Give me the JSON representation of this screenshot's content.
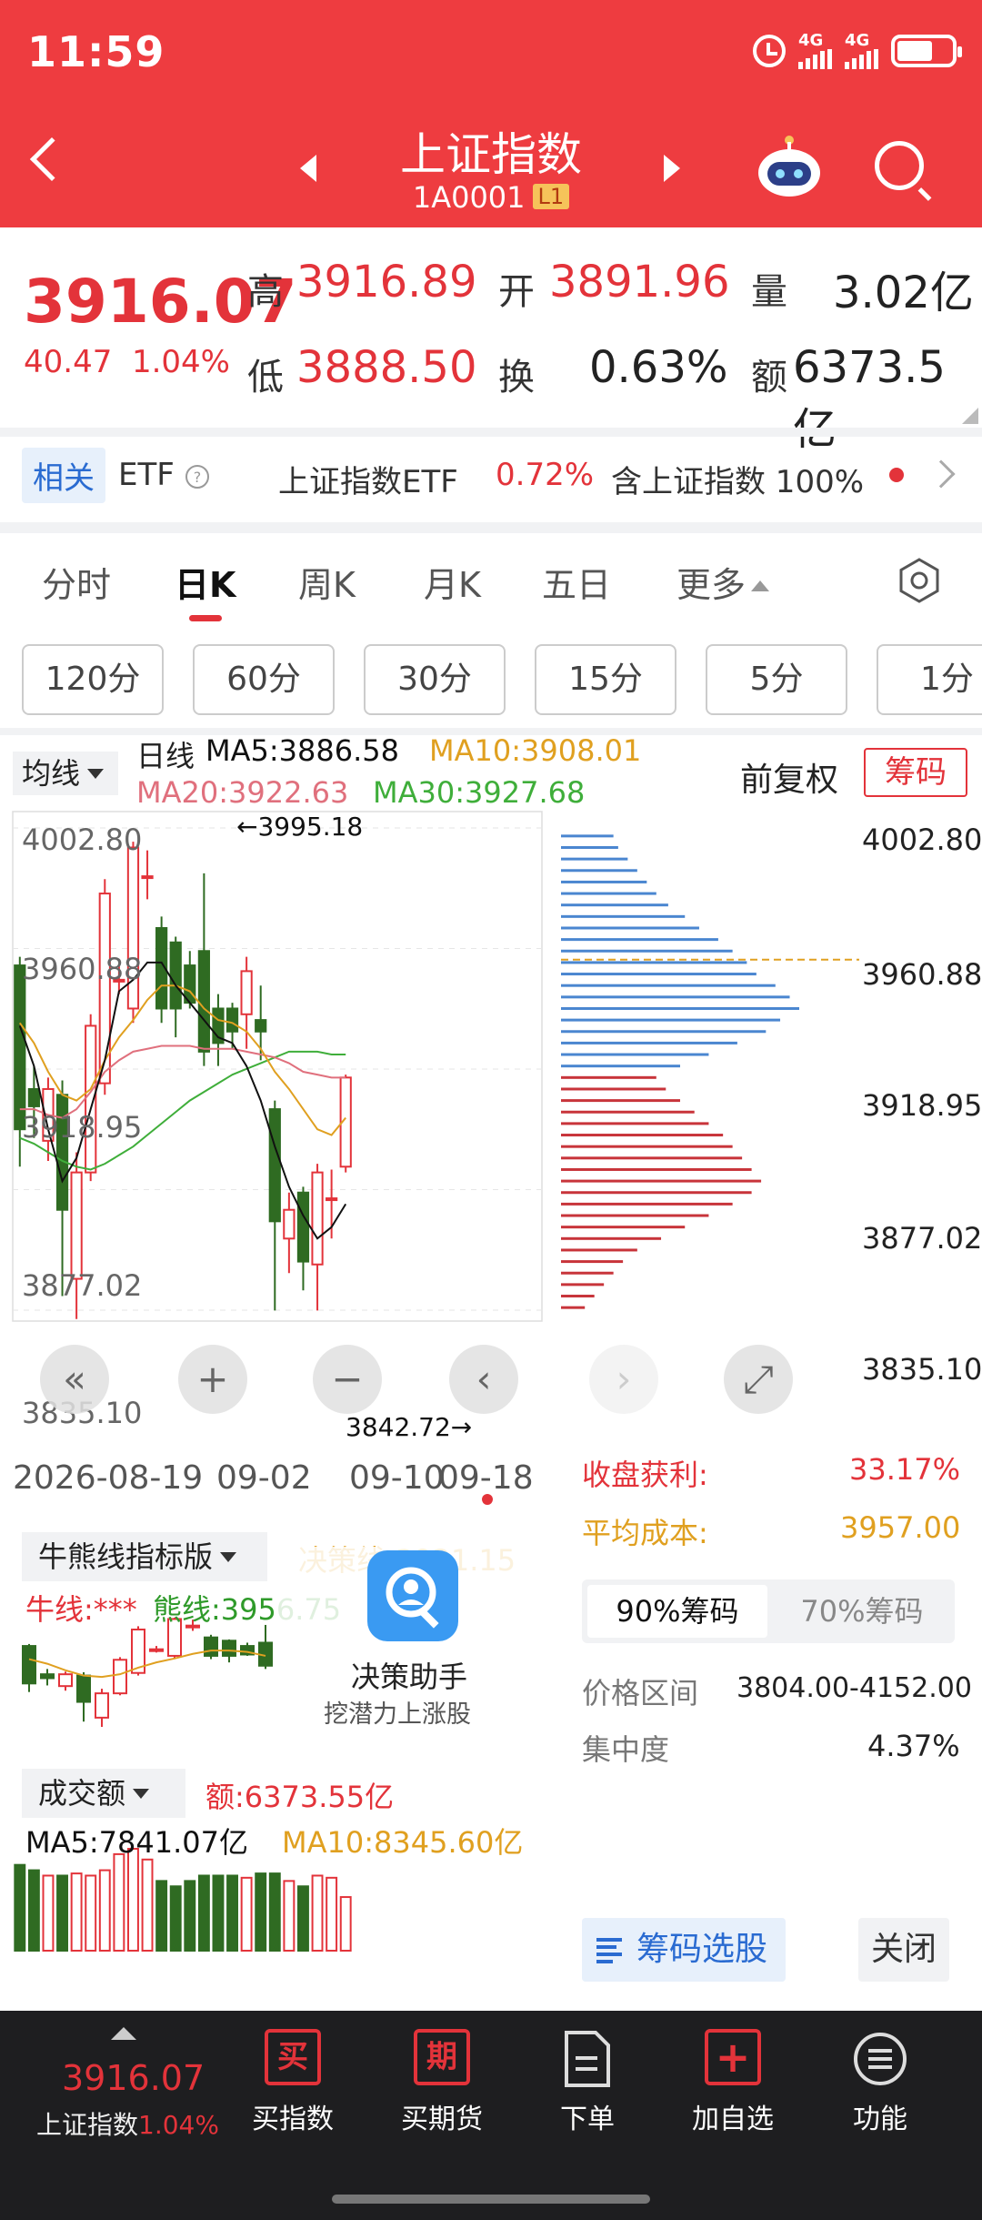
{
  "status": {
    "time": "11:59",
    "net1": "4G",
    "net2": "4G"
  },
  "header": {
    "title": "上证指数",
    "code": "1A0001",
    "badge": "L1"
  },
  "quote": {
    "price": "3916.07",
    "change": "40.47",
    "change_pct": "1.04%",
    "high_label": "高",
    "high": "3916.89",
    "open_label": "开",
    "open": "3891.96",
    "volume_label": "量",
    "volume": "3.02亿",
    "low_label": "低",
    "low": "3888.50",
    "turnover_label": "换",
    "turnover": "0.63%",
    "amount_label": "额",
    "amount": "6373.5亿"
  },
  "etf": {
    "tag": "相关",
    "label": "ETF",
    "name": "上证指数ETF",
    "pct": "0.72%",
    "contains": "含上证指数 100%"
  },
  "tabs": [
    "分时",
    "日K",
    "周K",
    "月K",
    "五日",
    "更多"
  ],
  "periods": [
    "120分",
    "60分",
    "30分",
    "15分",
    "5分",
    "1分"
  ],
  "ma": {
    "selector": "均线",
    "kind": "日线",
    "ma5": "MA5:3886.58",
    "ma10": "MA10:3908.01",
    "ma20": "MA20:3922.63",
    "ma30": "MA30:3927.68",
    "fuquan": "前复权",
    "chouma": "筹码"
  },
  "chart_axis": {
    "y_labels": [
      "4002.80",
      "3960.88",
      "3918.95",
      "3877.02",
      "3835.10"
    ],
    "max_annot": "←3995.18",
    "min_annot": "3842.72→"
  },
  "chip_axis": {
    "y_labels": [
      "4002.80",
      "3960.88",
      "3918.95",
      "3877.02",
      "3835.10"
    ]
  },
  "dates": {
    "d1": "2026-08-19",
    "d2": "09-02",
    "d3": "09-10",
    "d4": "09-18"
  },
  "chip_info": {
    "profit_label": "收盘获利:",
    "profit": "33.17%",
    "cost_label": "平均成本:",
    "cost": "3957.00",
    "tab_90": "90%筹码",
    "tab_70": "70%筹码",
    "range_label": "价格区间",
    "range": "3804.00-4152.00",
    "conc_label": "集中度",
    "conc": "4.37%",
    "select_btn": "筹码选股",
    "close_btn": "关闭"
  },
  "indicator": {
    "name": "牛熊线指标版",
    "decision": "决策线:3921.15",
    "bull": "牛线:***",
    "bear": "熊线:3956.75",
    "assistant_title": "决策助手",
    "assistant_sub": "挖潜力上涨股"
  },
  "volume": {
    "name": "成交额",
    "amount": "额:6373.55亿",
    "ma5": "MA5:7841.07亿",
    "ma10": "MA10:8345.60亿"
  },
  "bottom": {
    "price": "3916.07",
    "name": "上证指数",
    "pct": "1.04%",
    "buy_index": "买指数",
    "buy_futures": "买期货",
    "order": "下单",
    "add_fav": "加自选",
    "functions": "功能",
    "buy_char": "买",
    "futures_char": "期",
    "add_char": "+"
  },
  "colors": {
    "red": "#e3333a",
    "green": "#2f6b22",
    "header": "#ee3c40",
    "orange": "#e0a020",
    "blue": "#2a6bd1"
  },
  "chart_data": {
    "type": "candlestick",
    "y_range": [
      3835.1,
      4002.8
    ],
    "candles": [
      {
        "o": 3955,
        "c": 3898,
        "h": 3958,
        "l": 3885
      },
      {
        "o": 3912,
        "c": 3906,
        "h": 3920,
        "l": 3895
      },
      {
        "o": 3894,
        "c": 3912,
        "h": 3916,
        "l": 3887
      },
      {
        "o": 3910,
        "c": 3870,
        "h": 3915,
        "l": 3840
      },
      {
        "o": 3846,
        "c": 3883,
        "h": 3890,
        "l": 3832
      },
      {
        "o": 3883,
        "c": 3934,
        "h": 3938,
        "l": 3880
      },
      {
        "o": 3914,
        "c": 3980,
        "h": 3985,
        "l": 3910
      },
      {
        "o": 3950,
        "c": 3950,
        "h": 3955,
        "l": 3945
      },
      {
        "o": 3940,
        "c": 3996,
        "h": 3998,
        "l": 3935
      },
      {
        "o": 3986,
        "c": 3986,
        "h": 3995,
        "l": 3978
      },
      {
        "o": 3968,
        "c": 3940,
        "h": 3972,
        "l": 3935
      },
      {
        "o": 3963,
        "c": 3940,
        "h": 3965,
        "l": 3930
      },
      {
        "o": 3955,
        "c": 3942,
        "h": 3960,
        "l": 3940
      },
      {
        "o": 3960,
        "c": 3925,
        "h": 3987,
        "l": 3920
      },
      {
        "o": 3940,
        "c": 3928,
        "h": 3945,
        "l": 3920
      },
      {
        "o": 3940,
        "c": 3932,
        "h": 3942,
        "l": 3926
      },
      {
        "o": 3938,
        "c": 3953,
        "h": 3958,
        "l": 3926
      },
      {
        "o": 3936,
        "c": 3932,
        "h": 3948,
        "l": 3922
      },
      {
        "o": 3905,
        "c": 3866,
        "h": 3908,
        "l": 3835
      },
      {
        "o": 3860,
        "c": 3870,
        "h": 3876,
        "l": 3848
      },
      {
        "o": 3876,
        "c": 3852,
        "h": 3878,
        "l": 3842
      },
      {
        "o": 3851,
        "c": 3883,
        "h": 3886,
        "l": 3835
      },
      {
        "o": 3874,
        "c": 3874,
        "h": 3884,
        "l": 3860
      },
      {
        "o": 3885,
        "c": 3916,
        "h": 3917,
        "l": 3883
      }
    ],
    "ma5": [
      3934,
      3920,
      3898,
      3880,
      3888,
      3905,
      3922,
      3946,
      3950,
      3956,
      3956,
      3948,
      3942,
      3936,
      3930,
      3928,
      3920,
      3908,
      3892,
      3878,
      3868,
      3860,
      3864,
      3872
    ],
    "ma10": [
      3935,
      3928,
      3918,
      3910,
      3908,
      3912,
      3922,
      3930,
      3936,
      3943,
      3948,
      3948,
      3946,
      3940,
      3936,
      3935,
      3932,
      3926,
      3918,
      3912,
      3905,
      3898,
      3896,
      3902
    ],
    "ma20": [
      3905,
      3905,
      3903,
      3902,
      3905,
      3911,
      3918,
      3922,
      3925,
      3926,
      3927,
      3927,
      3927,
      3926,
      3926,
      3926,
      3925,
      3924,
      3923,
      3921,
      3918,
      3917,
      3916,
      3916
    ],
    "ma30": [
      3895,
      3893,
      3890,
      3887,
      3885,
      3884,
      3886,
      3889,
      3892,
      3896,
      3900,
      3904,
      3908,
      3911,
      3914,
      3917,
      3919,
      3921,
      3923,
      3925,
      3925,
      3925,
      3924,
      3924
    ],
    "volume": [
      8,
      7.5,
      7,
      7,
      7.2,
      7,
      7.5,
      9,
      9.5,
      8.5,
      6.5,
      6,
      6.5,
      7,
      7,
      7,
      6.8,
      7.2,
      7.2,
      6.5,
      6,
      7,
      6.8,
      5
    ]
  },
  "chip_distribution": {
    "prices": [
      4000,
      3996,
      3992,
      3988,
      3984,
      3980,
      3976,
      3972,
      3968,
      3964,
      3960,
      3956,
      3952,
      3948,
      3944,
      3940,
      3936,
      3932,
      3928,
      3924,
      3920,
      3916,
      3912,
      3908,
      3904,
      3900,
      3896,
      3892,
      3888,
      3884,
      3880,
      3876,
      3872,
      3868,
      3864,
      3860,
      3856,
      3852,
      3848,
      3844,
      3840,
      3836
    ],
    "weights": [
      0.22,
      0.24,
      0.28,
      0.32,
      0.36,
      0.4,
      0.45,
      0.52,
      0.58,
      0.66,
      0.72,
      0.78,
      0.82,
      0.9,
      0.96,
      1.0,
      0.92,
      0.86,
      0.74,
      0.62,
      0.5,
      0.4,
      0.44,
      0.5,
      0.56,
      0.62,
      0.68,
      0.72,
      0.76,
      0.8,
      0.84,
      0.8,
      0.72,
      0.62,
      0.52,
      0.42,
      0.32,
      0.26,
      0.22,
      0.18,
      0.14,
      0.1
    ],
    "avg_cost": 3957.0
  }
}
